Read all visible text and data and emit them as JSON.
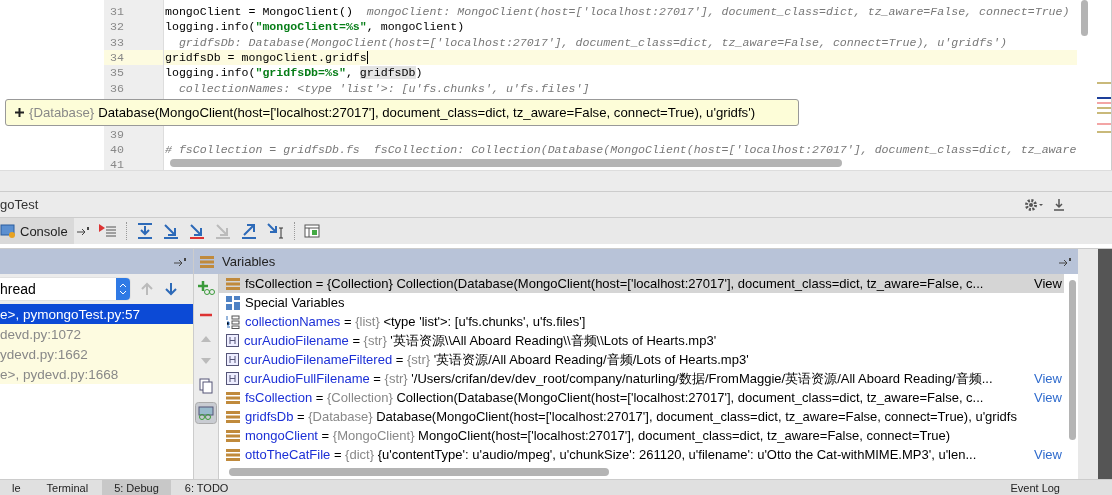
{
  "editor": {
    "lines": [
      {
        "number": "31",
        "current": false,
        "segments": [
          {
            "kind": "code",
            "text": "mongoClient = MongoClient()"
          },
          {
            "kind": "hint",
            "text": "  mongoClient: MongoClient(host=['localhost:27017'], document_class=dict, tz_aware=False, connect=True)"
          }
        ]
      },
      {
        "number": "32",
        "current": false,
        "segments": [
          {
            "kind": "code",
            "text": "logging.info("
          },
          {
            "kind": "string",
            "text": "\"mongoClient=%s\""
          },
          {
            "kind": "code",
            "text": ", mongoClient)"
          }
        ]
      },
      {
        "number": "33",
        "current": false,
        "segments": [
          {
            "kind": "hint",
            "text": "  gridfsDb: Database(MongoClient(host=['localhost:27017'], document_class=dict, tz_aware=False, connect=True), u'gridfs')"
          }
        ]
      },
      {
        "number": "34",
        "current": true,
        "segments": [
          {
            "kind": "code",
            "text": "gridfsDb = mongoClient.gridfs"
          }
        ]
      },
      {
        "number": "35",
        "current": false,
        "segments": [
          {
            "kind": "code",
            "text": "logging.info("
          },
          {
            "kind": "string",
            "text": "\"gridfsDb=%s\""
          },
          {
            "kind": "code",
            "text": ", "
          },
          {
            "kind": "ref",
            "text": "gridfsDb"
          },
          {
            "kind": "code",
            "text": ")"
          }
        ]
      },
      {
        "number": "36",
        "current": false,
        "segments": [
          {
            "kind": "hint",
            "text": "  collectionNames: <type 'list'>: [u'fs.chunks', u'fs.files']"
          }
        ]
      },
      {
        "kind": "tooltip",
        "type": "{Database}",
        "value": "Database(MongoClient(host=['localhost:27017'], document_class=dict, tz_aware=False, connect=True), u'gridfs')"
      },
      {
        "number": "39",
        "current": false
      },
      {
        "number": "40",
        "current": false,
        "segments": [
          {
            "kind": "comment",
            "text": "# fsCollection = gridfsDb.fs"
          },
          {
            "kind": "hint",
            "text": "  fsCollection: Collection(Database(MongoClient(host=['localhost:27017'], document_class=dict, tz_aware"
          }
        ]
      },
      {
        "number": "41",
        "current": false
      }
    ]
  },
  "debug": {
    "title": "goTest",
    "console_tab": "Console",
    "frames": {
      "thread": "hread",
      "items": [
        {
          "text": "e>, pymongoTest.py:57",
          "selected": true
        },
        {
          "text": "devd.py:1072",
          "selected": false
        },
        {
          "text": "ydevd.py:1662",
          "selected": false
        },
        {
          "text": "e>, pydevd.py:1668",
          "selected": false
        }
      ]
    },
    "variables": {
      "title": "Variables",
      "rows": [
        {
          "kind": "field",
          "name": "fsCollection",
          "operator": "=",
          "type": "{Collection}",
          "value": "Collection(Database(MongoClient(host=['localhost:27017'], document_class=dict, tz_aware=False, c...",
          "view": "View",
          "selected": true
        },
        {
          "kind": "special",
          "name": "Special Variables",
          "selected": false
        },
        {
          "kind": "list",
          "name": "collectionNames",
          "operator": "=",
          "type": "{list}",
          "value": "<type 'list'>: [u'fs.chunks', u'fs.files']",
          "selected": false
        },
        {
          "kind": "str",
          "name": "curAudioFilename",
          "operator": "=",
          "type": "{str}",
          "value": "'英语资源\\\\All Aboard Reading\\\\音频\\\\Lots of Hearts.mp3'",
          "selected": false
        },
        {
          "kind": "str",
          "name": "curAudioFilenameFiltered",
          "operator": "=",
          "type": "{str}",
          "value": "'英语资源/All Aboard Reading/音频/Lots of Hearts.mp3'",
          "selected": false
        },
        {
          "kind": "str",
          "name": "curAudioFullFilename",
          "operator": "=",
          "type": "{str}",
          "value": "'/Users/crifan/dev/dev_root/company/naturling/数据/FromMaggie/英语资源/All Aboard Reading/音频...",
          "view": "View",
          "selected": false
        },
        {
          "kind": "field",
          "name": "fsCollection",
          "operator": "=",
          "type": "{Collection}",
          "value": "Collection(Database(MongoClient(host=['localhost:27017'], document_class=dict, tz_aware=False, c...",
          "view": "View",
          "selected": false
        },
        {
          "kind": "field",
          "name": "gridfsDb",
          "operator": "=",
          "type": "{Database}",
          "value": "Database(MongoClient(host=['localhost:27017'], document_class=dict, tz_aware=False, connect=True), u'gridfs",
          "selected": false
        },
        {
          "kind": "field",
          "name": "mongoClient",
          "operator": "=",
          "type": "{MongoClient}",
          "value": "MongoClient(host=['localhost:27017'], document_class=dict, tz_aware=False, connect=True)",
          "selected": false
        },
        {
          "kind": "field",
          "name": "ottoTheCatFile",
          "operator": "=",
          "type": "{dict}",
          "value": "{u'contentType': u'audio/mpeg', u'chunkSize': 261120, u'filename': u'Otto the Cat-withMIME.MP3', u'len...",
          "view": "View",
          "selected": false
        }
      ]
    }
  },
  "bottom_tabs": [
    {
      "label": "le",
      "selected": false
    },
    {
      "label": "Terminal",
      "selected": false
    },
    {
      "label": "5: Debug",
      "selected": true
    },
    {
      "label": "6: TODO",
      "selected": false
    },
    {
      "label": "Event Log",
      "selected": false
    }
  ]
}
